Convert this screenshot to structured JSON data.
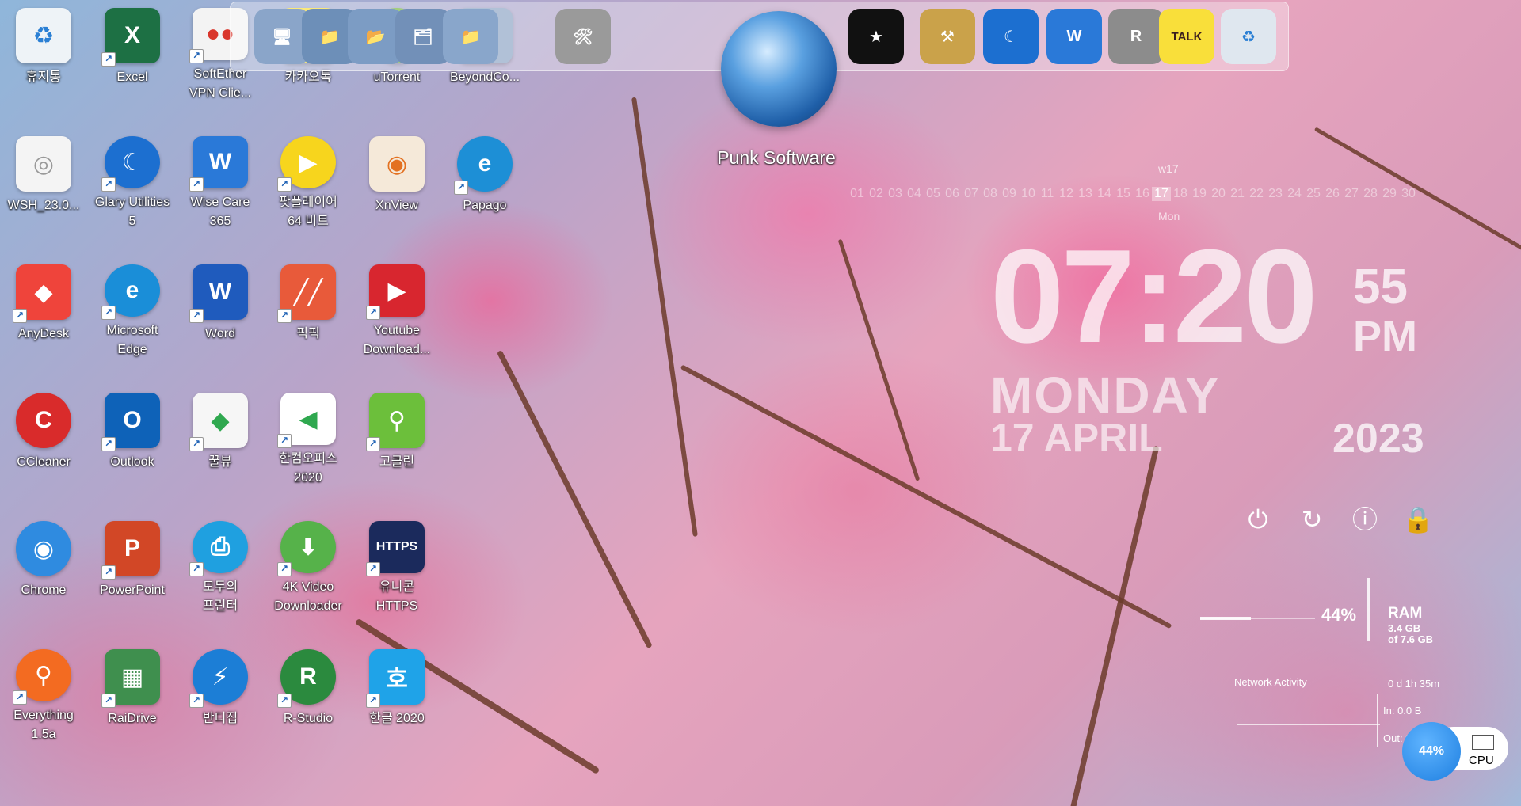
{
  "desktop_icons": [
    {
      "label": "휴지통",
      "icon": "recycle-bin-icon",
      "color": "#eef3f7",
      "glyph": "♻",
      "glyphColor": "#2a7fd4",
      "shortcut": false,
      "shape": "square"
    },
    {
      "label": "Excel",
      "icon": "excel-icon",
      "color": "#1d7044",
      "glyph": "X",
      "glyphColor": "#ffffff",
      "shortcut": true,
      "shape": "square"
    },
    {
      "label": "SoftEther\nVPN Clie...",
      "icon": "softether-vpn-icon",
      "color": "#f3f3f3",
      "glyph": "●●",
      "glyphColor": "#d9362b",
      "shortcut": true,
      "shape": "square"
    },
    {
      "label": "카카오톡",
      "icon": "kakaotalk-icon",
      "color": "#f9df3a",
      "glyph": "TALK",
      "glyphColor": "#3b1e1e",
      "shortcut": false,
      "shape": "square"
    },
    {
      "label": "uTorrent",
      "icon": "utorrent-icon",
      "color": "#78b83e",
      "glyph": "µ",
      "glyphColor": "#ffffff",
      "shortcut": false,
      "shape": "circle"
    },
    {
      "label": "BeyondCo...",
      "icon": "beyond-compare-icon",
      "color": "#8da4c4",
      "glyph": "⇆",
      "glyphColor": "#ffffff",
      "shortcut": false,
      "shape": "square"
    },
    {
      "label": "WSH_23.0...",
      "icon": "file-icon",
      "color": "#f4f4f4",
      "glyph": "◎",
      "glyphColor": "#9a9a9a",
      "shortcut": false,
      "shape": "square"
    },
    {
      "label": "Glary Utilities\n5",
      "icon": "glary-utilities-icon",
      "color": "#1c6fd0",
      "glyph": "☾",
      "glyphColor": "#ffffff",
      "shortcut": true,
      "shape": "circle"
    },
    {
      "label": "Wise Care\n365",
      "icon": "wise-care-icon",
      "color": "#2a79d8",
      "glyph": "W",
      "glyphColor": "#ffffff",
      "shortcut": true,
      "shape": "square"
    },
    {
      "label": "팟플레이어\n64 비트",
      "icon": "potplayer-icon",
      "color": "#f7d51d",
      "glyph": "▶",
      "glyphColor": "#ffffff",
      "shortcut": true,
      "shape": "circle"
    },
    {
      "label": "XnView",
      "icon": "xnview-icon",
      "color": "#f5e9d9",
      "glyph": "◉",
      "glyphColor": "#e37121",
      "shortcut": false,
      "shape": "square"
    },
    {
      "label": "Papago",
      "icon": "papago-icon",
      "color": "#1d8fd6",
      "glyph": "e",
      "glyphColor": "#ffffff",
      "shortcut": true,
      "shape": "circle"
    },
    {
      "label": "AnyDesk",
      "icon": "anydesk-icon",
      "color": "#ef443b",
      "glyph": "◆",
      "glyphColor": "#ffffff",
      "shortcut": true,
      "shape": "square"
    },
    {
      "label": "Microsoft\nEdge",
      "icon": "edge-icon",
      "color": "#1a8ed8",
      "glyph": "e",
      "glyphColor": "#ffffff",
      "shortcut": true,
      "shape": "circle"
    },
    {
      "label": "Word",
      "icon": "word-icon",
      "color": "#1f5bbd",
      "glyph": "W",
      "glyphColor": "#ffffff",
      "shortcut": true,
      "shape": "square"
    },
    {
      "label": "픽픽",
      "icon": "picpick-icon",
      "color": "#e85a3a",
      "glyph": "╱╱",
      "glyphColor": "#ffffff",
      "shortcut": true,
      "shape": "square"
    },
    {
      "label": "Youtube\nDownload...",
      "icon": "youtube-downloader-icon",
      "color": "#d8262f",
      "glyph": "▶",
      "glyphColor": "#ffffff",
      "shortcut": true,
      "shape": "square"
    },
    {
      "label": "",
      "icon": "empty-slot",
      "color": "",
      "glyph": "",
      "glyphColor": "",
      "shortcut": false,
      "shape": "none"
    },
    {
      "label": "CCleaner",
      "icon": "ccleaner-icon",
      "color": "#d92b2b",
      "glyph": "C",
      "glyphColor": "#ffffff",
      "shortcut": false,
      "shape": "circle"
    },
    {
      "label": "Outlook",
      "icon": "outlook-icon",
      "color": "#0e62b8",
      "glyph": "O",
      "glyphColor": "#ffffff",
      "shortcut": true,
      "shape": "square"
    },
    {
      "label": "꿀뷰",
      "icon": "honeyview-icon",
      "color": "#f6f6f6",
      "glyph": "◆",
      "glyphColor": "#2fa84f",
      "shortcut": true,
      "shape": "square"
    },
    {
      "label": "한컴오피스\n2020",
      "icon": "hancom-office-icon",
      "color": "#ffffff",
      "glyph": "◀",
      "glyphColor": "#2fa84f",
      "shortcut": true,
      "shape": "square"
    },
    {
      "label": "고클린",
      "icon": "goclean-icon",
      "color": "#6cbf3b",
      "glyph": "⚲",
      "glyphColor": "#ffffff",
      "shortcut": true,
      "shape": "square"
    },
    {
      "label": "",
      "icon": "empty-slot",
      "color": "",
      "glyph": "",
      "glyphColor": "",
      "shortcut": false,
      "shape": "none"
    },
    {
      "label": "Chrome",
      "icon": "chrome-icon",
      "color": "#2f8be0",
      "glyph": "◉",
      "glyphColor": "#ffffff",
      "shortcut": false,
      "shape": "circle"
    },
    {
      "label": "PowerPoint",
      "icon": "powerpoint-icon",
      "color": "#d24726",
      "glyph": "P",
      "glyphColor": "#ffffff",
      "shortcut": true,
      "shape": "square"
    },
    {
      "label": "모두의\n프린터",
      "icon": "printer-icon",
      "color": "#1fa0e0",
      "glyph": "⎙",
      "glyphColor": "#ffffff",
      "shortcut": true,
      "shape": "circle"
    },
    {
      "label": "4K Video\nDownloader",
      "icon": "4k-video-downloader-icon",
      "color": "#56b24a",
      "glyph": "⬇",
      "glyphColor": "#ffffff",
      "shortcut": true,
      "shape": "circle"
    },
    {
      "label": "유니콘\nHTTPS",
      "icon": "unicorn-https-icon",
      "color": "#1b2a5c",
      "glyph": "HTTPS",
      "glyphColor": "#ffffff",
      "shortcut": true,
      "shape": "square"
    },
    {
      "label": "",
      "icon": "empty-slot",
      "color": "",
      "glyph": "",
      "glyphColor": "",
      "shortcut": false,
      "shape": "none"
    },
    {
      "label": "Everything\n1.5a",
      "icon": "everything-search-icon",
      "color": "#f36b21",
      "glyph": "⚲",
      "glyphColor": "#ffffff",
      "shortcut": true,
      "shape": "circle"
    },
    {
      "label": "RaiDrive",
      "icon": "raidrive-icon",
      "color": "#3f8f4e",
      "glyph": "▦",
      "glyphColor": "#ffffff",
      "shortcut": true,
      "shape": "square"
    },
    {
      "label": "반디집",
      "icon": "bandizip-icon",
      "color": "#1c7ed6",
      "glyph": "⚡",
      "glyphColor": "#ffffff",
      "shortcut": true,
      "shape": "circle"
    },
    {
      "label": "R-Studio",
      "icon": "r-studio-icon",
      "color": "#2b8a3e",
      "glyph": "R",
      "glyphColor": "#ffffff",
      "shortcut": true,
      "shape": "circle"
    },
    {
      "label": "한글 2020",
      "icon": "hangul-2020-icon",
      "color": "#1fa3e8",
      "glyph": "호",
      "glyphColor": "#ffffff",
      "shortcut": true,
      "shape": "square"
    }
  ],
  "dock": {
    "items": [
      {
        "icon": "dock-network-computer-icon",
        "color": "#8aa5c9",
        "glyph": "🖥"
      },
      {
        "icon": "dock-folder-network-icon",
        "color": "#6d8fb8",
        "glyph": "📁"
      },
      {
        "icon": "dock-folder-search-icon",
        "color": "#7c9cc4",
        "glyph": "📂"
      },
      {
        "icon": "dock-folder-settings-icon",
        "color": "#7290b8",
        "glyph": "🗂"
      },
      {
        "icon": "dock-folder-icon",
        "color": "#89a6cb",
        "glyph": "📁"
      },
      {
        "icon": "dock-tools-icon",
        "color": "#9a9a9a",
        "glyph": "🛠"
      },
      {
        "icon": "dock-tshirt-icon",
        "color": "#111111",
        "glyph": "★"
      },
      {
        "icon": "dock-pickaxe-icon",
        "color": "#caa24a",
        "glyph": "⚒"
      },
      {
        "icon": "dock-glary-icon",
        "color": "#1c6fd0",
        "glyph": "☾"
      },
      {
        "icon": "dock-wise-care-icon",
        "color": "#2a79d8",
        "glyph": "W"
      },
      {
        "icon": "dock-registry-icon",
        "color": "#8c8c8c",
        "glyph": "R"
      },
      {
        "icon": "dock-kakaotalk-icon",
        "color": "#f9df3a",
        "glyph": "TALK"
      },
      {
        "icon": "dock-recycle-bin-icon",
        "color": "#dfe7ef",
        "glyph": "♻"
      }
    ]
  },
  "punk": {
    "label": "Punk Software"
  },
  "calendar": {
    "week": "w17",
    "days": [
      "01",
      "02",
      "03",
      "04",
      "05",
      "06",
      "07",
      "08",
      "09",
      "10",
      "11",
      "12",
      "13",
      "14",
      "15",
      "16",
      "17",
      "18",
      "19",
      "20",
      "21",
      "22",
      "23",
      "24",
      "25",
      "26",
      "27",
      "28",
      "29",
      "30"
    ],
    "today": "17",
    "dow": "Mon"
  },
  "clock": {
    "time": "07:20",
    "seconds": "55",
    "ampm": "PM",
    "day": "MONDAY",
    "date": "17 APRIL",
    "year": "2023"
  },
  "power": [
    {
      "icon": "power-off-icon",
      "glyph": "⏻"
    },
    {
      "icon": "restart-icon",
      "glyph": "↻"
    },
    {
      "icon": "logoff-icon",
      "glyph": "ⓘ"
    },
    {
      "icon": "lock-icon",
      "glyph": "🔒"
    }
  ],
  "ram": {
    "percent_label": "44%",
    "fraction": 0.44,
    "title": "RAM",
    "used": "3.4 GB",
    "total": "of 7.6 GB"
  },
  "network": {
    "title": "Network Activity",
    "uptime": "0 d 1h 35m",
    "in": "In: 0.0 B",
    "out": "Out: 0.0 B"
  },
  "cpu": {
    "percent_label": "44%",
    "label": "CPU"
  }
}
